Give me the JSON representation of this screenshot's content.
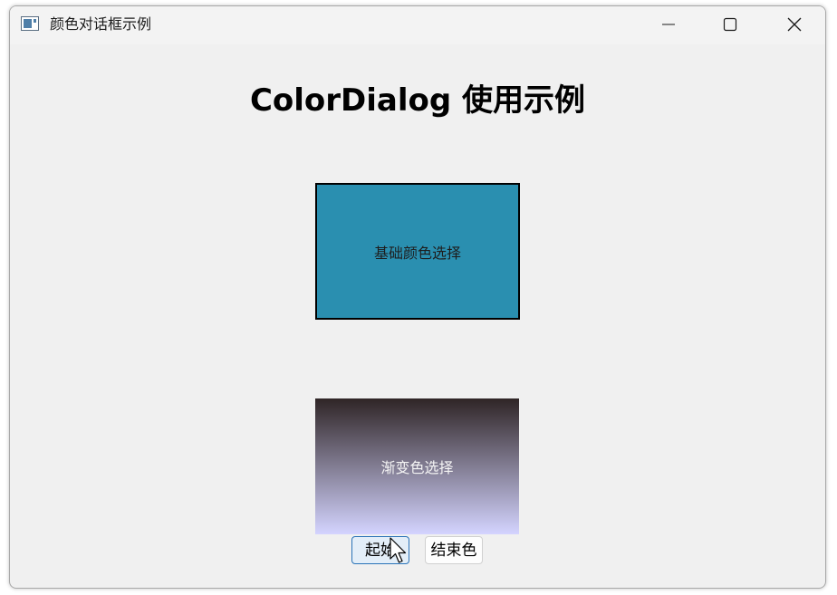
{
  "window": {
    "title": "颜色对话框示例",
    "icon": "app-window-icon",
    "controls": [
      "minimize-icon",
      "maximize-icon",
      "close-icon"
    ]
  },
  "main": {
    "heading": "ColorDialog 使用示例",
    "basic_color_box": {
      "label": "基础颜色选择",
      "fill_color": "#2a8fb0"
    },
    "gradient_box": {
      "label": "渐变色选择",
      "start_color": "#2f2526",
      "end_color": "#d4d4ff"
    },
    "start_button": {
      "label": "起始"
    },
    "end_button": {
      "label": "结束色"
    }
  },
  "colors": {
    "window_background": "#f0f0f0",
    "accent_border": "#2a73b8"
  }
}
